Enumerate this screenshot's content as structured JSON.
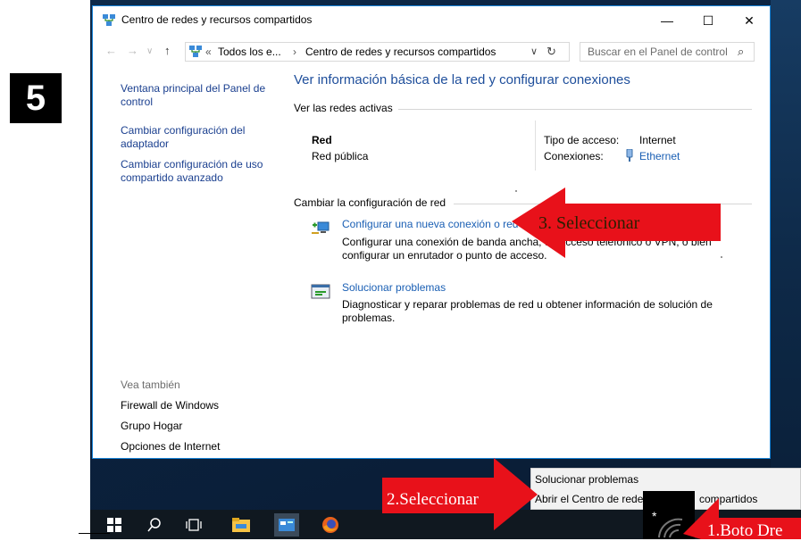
{
  "step_number": "5",
  "window": {
    "title": "Centro de redes y recursos compartidos",
    "controls": {
      "minimize": "—",
      "maximize": "☐",
      "close": "✕"
    }
  },
  "nav": {
    "back": "←",
    "forward": "→",
    "recent": "∨",
    "up": "↑",
    "address": {
      "prefix": "«",
      "crumb1": "Todos los e...",
      "separator": "›",
      "crumb2": "Centro de redes y recursos compartidos",
      "dropdown": "∨",
      "refresh": "↻"
    },
    "search_placeholder": "Buscar en el Panel de control",
    "search_icon": "⌕"
  },
  "left_pane": {
    "links": [
      "Ventana principal del Panel de control",
      "Cambiar configuración del adaptador",
      "Cambiar configuración de uso compartido avanzado"
    ],
    "see_also_heading": "Vea también",
    "see_also": [
      "Firewall de Windows",
      "Grupo Hogar",
      "Opciones de Internet"
    ]
  },
  "main": {
    "title": "Ver información básica de la red y configurar conexiones",
    "active_networks_label": "Ver las redes activas",
    "network": {
      "name": "Red",
      "type": "Red pública",
      "access_label": "Tipo de acceso:",
      "access_value": "Internet",
      "connections_label": "Conexiones:",
      "connections_value": "Ethernet"
    },
    "change_settings_label": "Cambiar la configuración de red",
    "tasks": [
      {
        "link": "Configurar una nueva conexión o red",
        "description": "Configurar una conexión de banda ancha, de acceso telefónico o VPN; o bien configurar un enrutador o punto de acceso."
      },
      {
        "link": "Solucionar problemas",
        "description": "Diagnosticar y reparar problemas de red u obtener información de solución de problemas."
      }
    ]
  },
  "context_menu": {
    "items": [
      "Solucionar problemas",
      "Abrir el Centro de redes"
    ],
    "item2_tail": "compartidos"
  },
  "annotations": {
    "step3": "3. Seleccionar",
    "step2": "2.Seleccionar",
    "step1": "1.Boto Dre"
  },
  "taskbar": {
    "icons": [
      "windows-start-icon",
      "search-icon",
      "task-view-icon",
      "file-explorer-icon",
      "control-panel-icon",
      "firefox-icon"
    ]
  },
  "colors": {
    "link_blue": "#1a5fb4",
    "title_blue": "#1e4e9b",
    "arrow_red": "#e8111a",
    "desktop": "#0b2240"
  }
}
